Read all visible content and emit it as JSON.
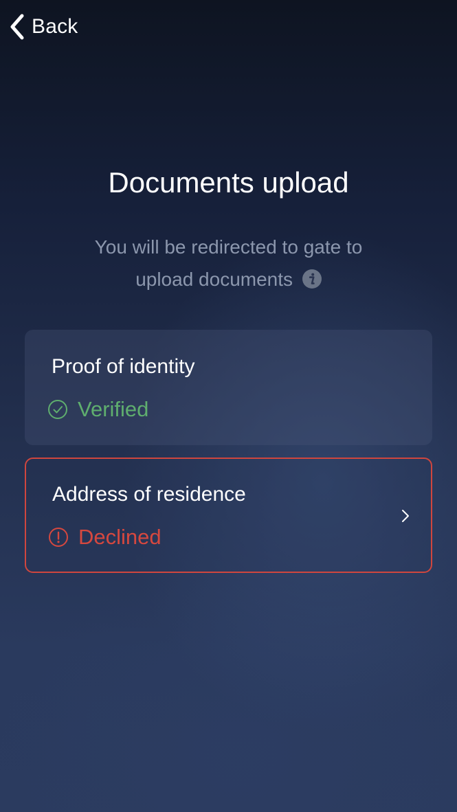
{
  "header": {
    "back_label": "Back",
    "back_icon": "chevron-left-icon"
  },
  "main": {
    "title": "Documents upload",
    "subtitle_line1": "You will be redirected to gate to",
    "subtitle_line2": "upload documents",
    "info_icon": "info-icon"
  },
  "documents": [
    {
      "title": "Proof of identity",
      "status": "Verified",
      "status_icon": "check-circle-icon",
      "status_color": "#5fae6e"
    },
    {
      "title": "Address of residence",
      "status": "Declined",
      "status_icon": "exclamation-circle-icon",
      "status_color": "#d6483f",
      "border_color": "#d0463e",
      "action_icon": "chevron-right-icon"
    }
  ]
}
